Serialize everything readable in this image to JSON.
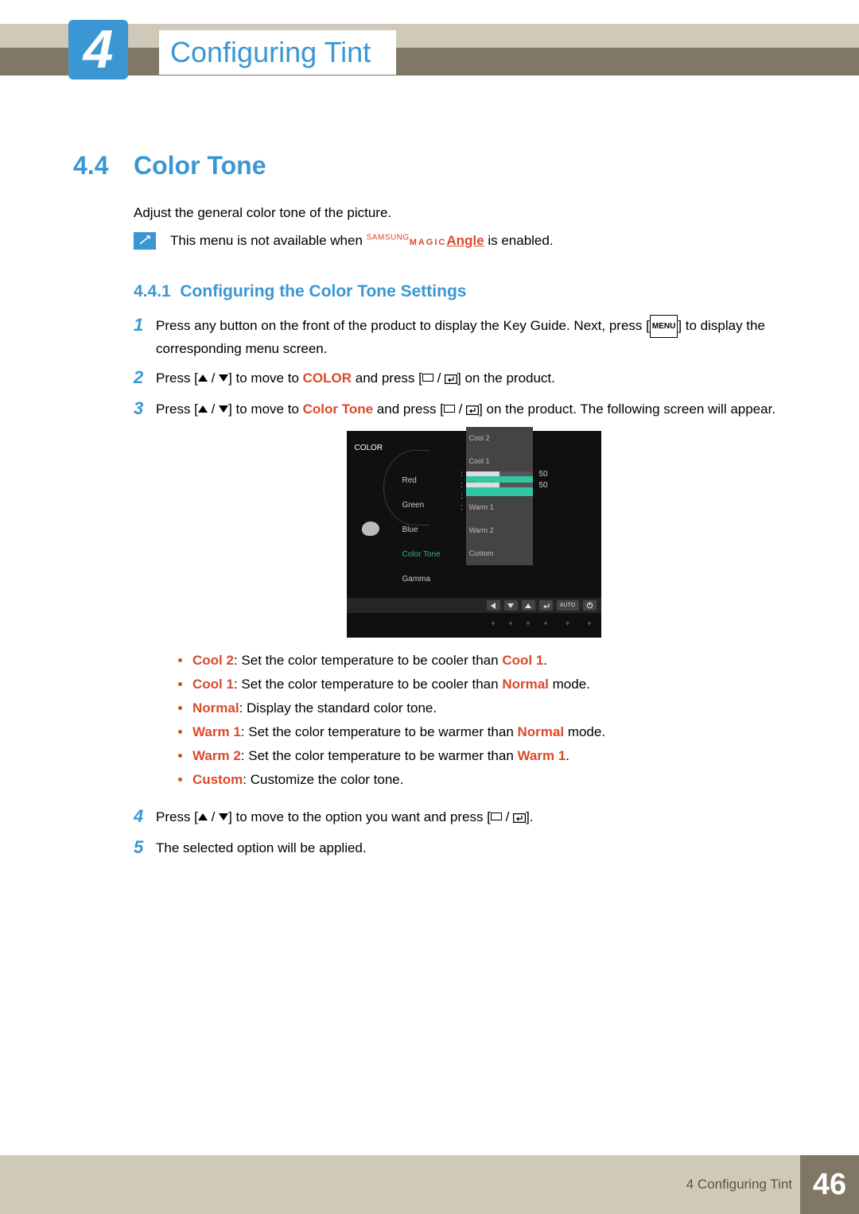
{
  "chapter": {
    "number": "4",
    "title": "Configuring Tint"
  },
  "section": {
    "number": "4.4",
    "title": "Color Tone",
    "intro": "Adjust the general color tone of the picture."
  },
  "note": {
    "prefix": "This menu is not available when ",
    "samsung": "SAMSUNG",
    "magic": "MAGIC",
    "angle": "Angle",
    "suffix": " is enabled."
  },
  "subsection": {
    "number": "4.4.1",
    "title": "Configuring the Color Tone Settings"
  },
  "steps": {
    "s1a": "Press any button on the front of the product to display the Key Guide. Next, press [",
    "s1_menu": "MENU",
    "s1b": "] to display the corresponding menu screen.",
    "s2a": "Press [",
    "s2b": "] to move to ",
    "s2_color": "COLOR",
    "s2c": " and press [",
    "s2d": "] on the product.",
    "s3a": "Press [",
    "s3b": "] to move to ",
    "s3_ct": "Color Tone",
    "s3c": " and press [",
    "s3d": "] on the product. The following screen will appear.",
    "s4a": "Press [",
    "s4b": "] to move to the option you want and press [",
    "s4c": "].",
    "s5": "The selected option will be applied."
  },
  "osd": {
    "title": "COLOR",
    "rows": {
      "red": "Red",
      "green": "Green",
      "blue": "Blue",
      "ct": "Color Tone",
      "gamma": "Gamma"
    },
    "v50a": "50",
    "v50b": "50",
    "dropdown": {
      "cool2": "Cool 2",
      "cool1": "Cool 1",
      "normal": "Normal",
      "warm1": "Warm 1",
      "warm2": "Warm 2",
      "custom": "Custom"
    },
    "auto": "AUTO"
  },
  "bullets": {
    "b1": {
      "t": "Cool 2",
      "d": ": Set the color temperature to be cooler than ",
      "r": "Cool 1",
      "e": "."
    },
    "b2": {
      "t": "Cool 1",
      "d": ": Set the color temperature to be cooler than ",
      "r": "Normal",
      "e": " mode."
    },
    "b3": {
      "t": "Normal",
      "d": ": Display the standard color tone."
    },
    "b4": {
      "t": "Warm 1",
      "d": ": Set the color temperature to be warmer than ",
      "r": "Normal",
      "e": " mode."
    },
    "b5": {
      "t": "Warm 2",
      "d": ": Set the color temperature to be warmer than ",
      "r": "Warm 1",
      "e": "."
    },
    "b6": {
      "t": "Custom",
      "d": ": Customize the color tone."
    }
  },
  "footer": {
    "text": "4 Configuring Tint",
    "page": "46"
  }
}
